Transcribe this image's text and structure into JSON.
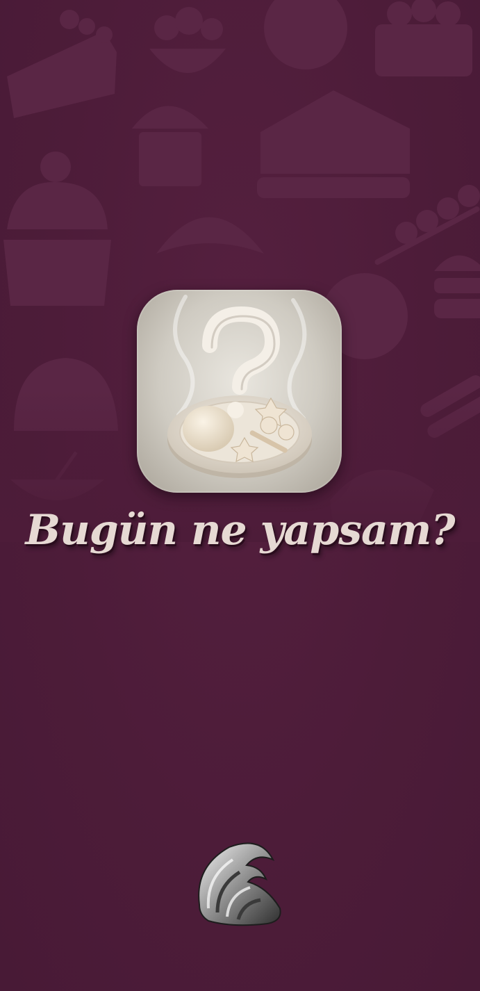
{
  "app": {
    "title": "Bugün ne yapsam?"
  },
  "background": {
    "color": "#4d1c39",
    "pattern_color": "#5a2645",
    "pattern_icons": [
      "cake-slice-icon",
      "salad-bowl-icon",
      "donut-icon",
      "cupcake-icon",
      "muffin-icon",
      "sandwich-icon",
      "croissant-icon",
      "skewer-icon",
      "burger-icon",
      "taco-icon",
      "sushi-icon",
      "pizza-icon"
    ]
  },
  "icons": {
    "app_icon": "plate-question-icon",
    "brand_logo": "wave-logo-icon"
  },
  "colors": {
    "title_text": "#e6d9d3",
    "icon_tile": "#d8d4cc"
  }
}
